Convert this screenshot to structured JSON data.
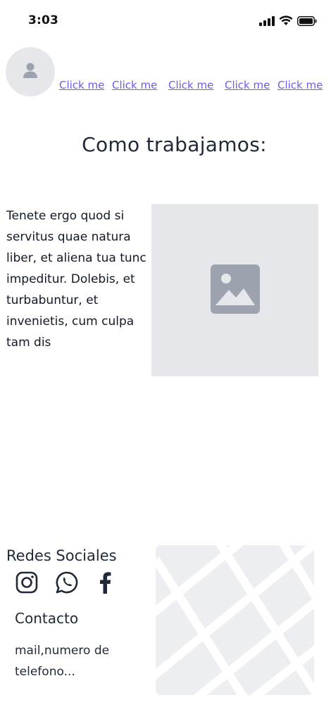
{
  "status_bar": {
    "time": "3:03",
    "signal_icon": "cellular-signal-icon",
    "wifi_icon": "wifi-icon",
    "battery_icon": "battery-icon"
  },
  "header": {
    "avatar_icon": "user-icon",
    "nav_links": [
      "Click me",
      "Click me",
      "Click me",
      "Click me",
      "Click me"
    ]
  },
  "main": {
    "title": "Como trabajamos:",
    "body": "Tenete ergo quod si servitus quae natura liber, et aliena tua tunc impeditur. Dolebis, et turbabuntur, et invenietis, cum culpa tam dis",
    "image_icon": "image-placeholder-icon"
  },
  "footer": {
    "social_heading": "Redes Sociales",
    "social_icons": [
      "instagram-icon",
      "whatsapp-icon",
      "facebook-icon"
    ],
    "contact_heading": "Contacto",
    "contact_text": "mail,numero de telefono...",
    "map_icon": "map-placeholder"
  },
  "colors": {
    "link": "#6d5ce8",
    "placeholder_bg": "#e5e7eb",
    "placeholder_icon": "#9ca3af",
    "text": "#1f2937"
  }
}
